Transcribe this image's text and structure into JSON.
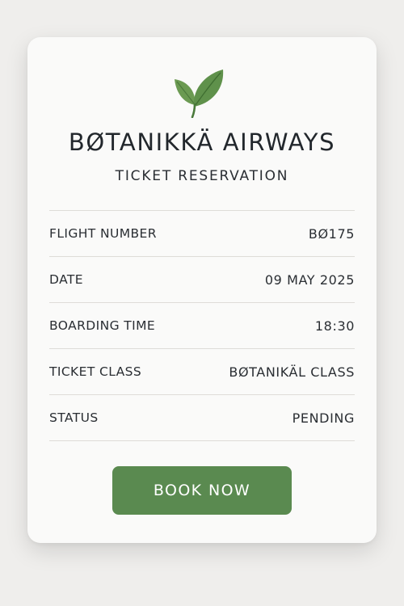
{
  "brand": {
    "name": "BØTANIKKÄ AIRWAYS",
    "subtitle": "TICKET RESERVATION",
    "logo_icon": "leaf-icon",
    "accent_color": "#5a8a50"
  },
  "details": [
    {
      "label": "FLIGHT NUMBER",
      "value": "BØ175"
    },
    {
      "label": "DATE",
      "value": "09 MAY 2025"
    },
    {
      "label": "BOARDING TIME",
      "value": "18:30"
    },
    {
      "label": "TICKET CLASS",
      "value": "BØTANIKÄL CLASS"
    },
    {
      "label": "STATUS",
      "value": "PENDING"
    }
  ],
  "actions": {
    "book_label": "BOOK NOW"
  }
}
